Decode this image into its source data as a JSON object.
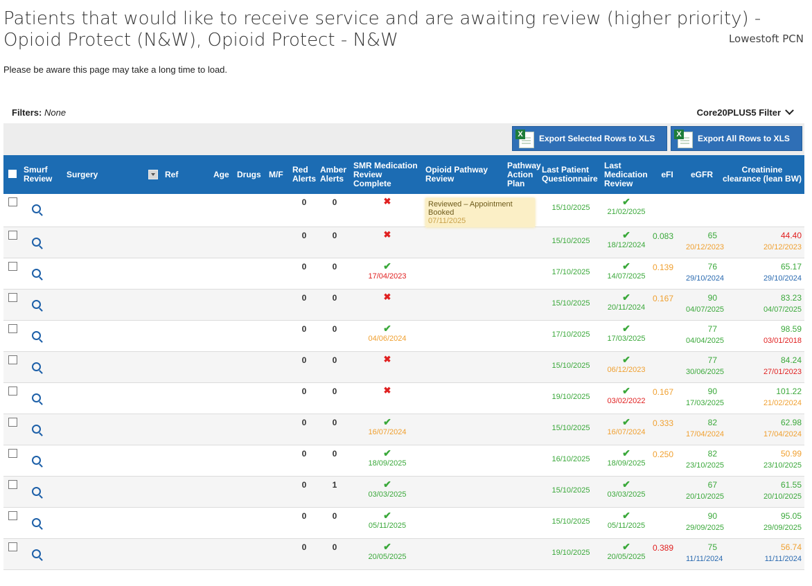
{
  "page": {
    "title": "Patients that would like to receive service and are awaiting review (higher priority) - Opioid Protect (N&W), Opioid Protect - N&W",
    "pcn": "Lowestoft PCN",
    "note": "Please be aware this page may take a long time to load.",
    "filters_label": "Filters:",
    "filters_value": "None",
    "core_filter": "Core20PLUS5 Filter"
  },
  "toolbar": {
    "export_selected": "Export Selected Rows to XLS",
    "export_all": "Export All Rows to XLS"
  },
  "columns": {
    "smurf": "Smurf Review",
    "surgery": "Surgery",
    "ref": "Ref",
    "age": "Age",
    "drugs": "Drugs",
    "mf": "M/F",
    "red": "Red Alerts",
    "amber": "Amber Alerts",
    "smr": "SMR Medication Review Complete",
    "opioid": "Opioid Pathway Review",
    "pathway": "Pathway Action Plan",
    "lpq": "Last Patient Questionnaire",
    "lmr": "Last Medication Review",
    "efi": "eFI",
    "egfr": "eGFR",
    "creat": "Creatinine clearance (lean BW)"
  },
  "rows": [
    {
      "red": "0",
      "amber": "0",
      "smr": "cross",
      "smr_date": "",
      "smr_c": "",
      "opioid": "Reviewed – Appointment Booked",
      "opioid_date": "07/11/2025",
      "lpq": "15/10/2025",
      "lmr_date": "21/02/2025",
      "lmr_c": "green",
      "efi": "",
      "efi_c": "",
      "egfr": "",
      "egfr_date": "",
      "egfr_c": "",
      "cr": "",
      "cr_date": "",
      "cr_c": ""
    },
    {
      "red": "0",
      "amber": "0",
      "smr": "cross",
      "smr_date": "",
      "smr_c": "",
      "opioid": "",
      "opioid_date": "",
      "lpq": "15/10/2025",
      "lmr_date": "18/12/2024",
      "lmr_c": "green",
      "efi": "0.083",
      "efi_c": "green",
      "egfr": "65",
      "egfr_date": "20/12/2023",
      "egfr_c": "orange",
      "cr": "44.40",
      "cr_date": "20/12/2023",
      "cr_c": "red",
      "crd_c": "orange"
    },
    {
      "red": "0",
      "amber": "0",
      "smr": "tick",
      "smr_date": "17/04/2023",
      "smr_c": "red",
      "opioid": "",
      "opioid_date": "",
      "lpq": "17/10/2025",
      "lmr_date": "14/07/2025",
      "lmr_c": "green",
      "efi": "0.139",
      "efi_c": "orange",
      "egfr": "76",
      "egfr_date": "29/10/2024",
      "egfr_c": "blue",
      "cr": "65.17",
      "cr_date": "29/10/2024",
      "cr_c": "green",
      "crd_c": "blue"
    },
    {
      "red": "0",
      "amber": "0",
      "smr": "cross",
      "smr_date": "",
      "smr_c": "",
      "opioid": "",
      "opioid_date": "",
      "lpq": "15/10/2025",
      "lmr_date": "20/11/2024",
      "lmr_c": "green",
      "efi": "0.167",
      "efi_c": "orange",
      "egfr": "90",
      "egfr_date": "04/07/2025",
      "egfr_c": "green",
      "cr": "83.23",
      "cr_date": "04/07/2025",
      "cr_c": "green",
      "crd_c": "green"
    },
    {
      "red": "0",
      "amber": "0",
      "smr": "tick",
      "smr_date": "04/06/2024",
      "smr_c": "orange",
      "opioid": "",
      "opioid_date": "",
      "lpq": "17/10/2025",
      "lmr_date": "17/03/2025",
      "lmr_c": "green",
      "efi": "",
      "efi_c": "",
      "egfr": "77",
      "egfr_date": "04/04/2025",
      "egfr_c": "green",
      "cr": "98.59",
      "cr_date": "03/01/2018",
      "cr_c": "green",
      "crd_c": "red"
    },
    {
      "red": "0",
      "amber": "0",
      "smr": "cross",
      "smr_date": "",
      "smr_c": "",
      "opioid": "",
      "opioid_date": "",
      "lpq": "15/10/2025",
      "lmr_date": "06/12/2023",
      "lmr_c": "orange",
      "efi": "",
      "efi_c": "",
      "egfr": "77",
      "egfr_date": "30/06/2025",
      "egfr_c": "green",
      "cr": "84.24",
      "cr_date": "27/01/2023",
      "cr_c": "green",
      "crd_c": "red"
    },
    {
      "red": "0",
      "amber": "0",
      "smr": "cross",
      "smr_date": "",
      "smr_c": "",
      "opioid": "",
      "opioid_date": "",
      "lpq": "19/10/2025",
      "lmr_date": "03/02/2022",
      "lmr_c": "red",
      "efi": "0.167",
      "efi_c": "orange",
      "egfr": "90",
      "egfr_date": "17/03/2025",
      "egfr_c": "green",
      "cr": "101.22",
      "cr_date": "21/02/2024",
      "cr_c": "green",
      "crd_c": "orange"
    },
    {
      "red": "0",
      "amber": "0",
      "smr": "tick",
      "smr_date": "16/07/2024",
      "smr_c": "orange",
      "opioid": "",
      "opioid_date": "",
      "lpq": "15/10/2025",
      "lmr_date": "16/07/2024",
      "lmr_c": "orange",
      "efi": "0.333",
      "efi_c": "orange",
      "egfr": "82",
      "egfr_date": "17/04/2024",
      "egfr_c": "orange",
      "cr": "62.98",
      "cr_date": "17/04/2024",
      "cr_c": "green",
      "crd_c": "orange"
    },
    {
      "red": "0",
      "amber": "0",
      "smr": "tick",
      "smr_date": "18/09/2025",
      "smr_c": "green",
      "opioid": "",
      "opioid_date": "",
      "lpq": "16/10/2025",
      "lmr_date": "18/09/2025",
      "lmr_c": "green",
      "efi": "0.250",
      "efi_c": "orange",
      "egfr": "82",
      "egfr_date": "23/10/2025",
      "egfr_c": "green",
      "cr": "50.99",
      "cr_date": "23/10/2025",
      "cr_c": "orange",
      "crd_c": "green"
    },
    {
      "red": "0",
      "amber": "1",
      "smr": "tick",
      "smr_date": "03/03/2025",
      "smr_c": "green",
      "opioid": "",
      "opioid_date": "",
      "lpq": "15/10/2025",
      "lmr_date": "03/03/2025",
      "lmr_c": "green",
      "efi": "",
      "efi_c": "",
      "egfr": "67",
      "egfr_date": "20/10/2025",
      "egfr_c": "green",
      "cr": "61.55",
      "cr_date": "20/10/2025",
      "cr_c": "green",
      "crd_c": "green"
    },
    {
      "red": "0",
      "amber": "0",
      "smr": "tick",
      "smr_date": "05/11/2025",
      "smr_c": "green",
      "opioid": "",
      "opioid_date": "",
      "lpq": "15/10/2025",
      "lmr_date": "05/11/2025",
      "lmr_c": "green",
      "efi": "",
      "efi_c": "",
      "egfr": "90",
      "egfr_date": "29/09/2025",
      "egfr_c": "green",
      "cr": "95.05",
      "cr_date": "29/09/2025",
      "cr_c": "green",
      "crd_c": "green"
    },
    {
      "red": "0",
      "amber": "0",
      "smr": "tick",
      "smr_date": "20/05/2025",
      "smr_c": "green",
      "opioid": "",
      "opioid_date": "",
      "lpq": "19/10/2025",
      "lmr_date": "20/05/2025",
      "lmr_c": "green",
      "efi": "0.389",
      "efi_c": "red",
      "egfr": "75",
      "egfr_date": "11/11/2024",
      "egfr_c": "blue",
      "cr": "56.74",
      "cr_date": "11/11/2024",
      "cr_c": "orange",
      "crd_c": "blue"
    }
  ],
  "colors": {
    "header": "#1c6cb3",
    "green": "#3aa83a",
    "orange": "#f0a030",
    "red": "#e02020",
    "blue": "#2a6ab0"
  }
}
